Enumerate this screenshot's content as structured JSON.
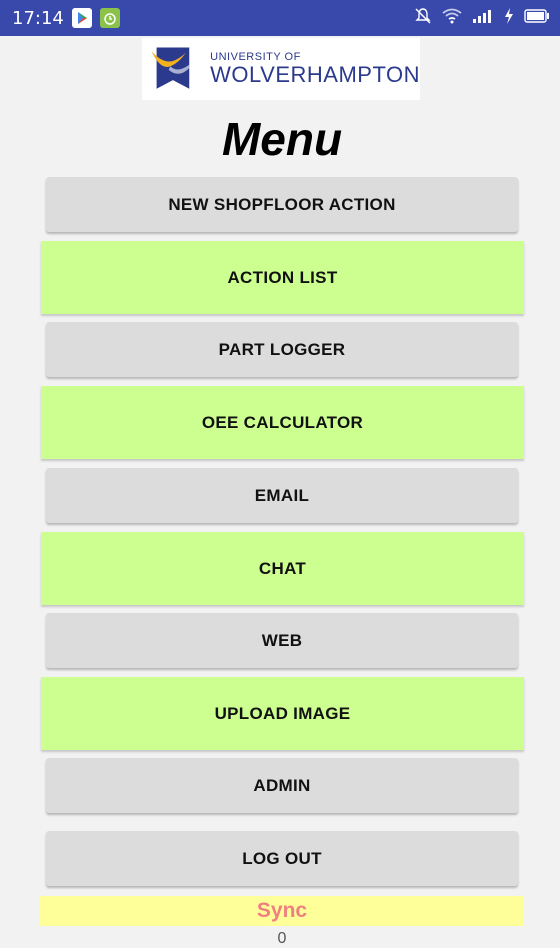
{
  "status_bar": {
    "time": "17:14",
    "icons": [
      "play-store-icon",
      "android-alarm-icon",
      "mute-bell-icon",
      "wifi-icon",
      "signal-icon",
      "charging-icon",
      "battery-icon"
    ],
    "color": "#3949ab"
  },
  "logo": {
    "line1": "UNIVERSITY OF",
    "line2": "WOLVERHAMPTON",
    "brand_color": "#2b3a8c",
    "accent_color": "#f2b01e"
  },
  "title": "Menu",
  "menu": {
    "items": [
      {
        "label": "NEW SHOPFLOOR ACTION",
        "style": "gray"
      },
      {
        "label": "ACTION LIST",
        "style": "green"
      },
      {
        "label": "PART LOGGER",
        "style": "gray"
      },
      {
        "label": "OEE CALCULATOR",
        "style": "green"
      },
      {
        "label": "EMAIL",
        "style": "gray"
      },
      {
        "label": "CHAT",
        "style": "green"
      },
      {
        "label": "WEB",
        "style": "gray"
      },
      {
        "label": "UPLOAD IMAGE",
        "style": "green"
      },
      {
        "label": "ADMIN",
        "style": "gray"
      },
      {
        "label": "LOG OUT",
        "style": "gray"
      }
    ],
    "colors": {
      "gray": "#dcdcdc",
      "green": "#ccff90"
    }
  },
  "sync": {
    "label": "Sync",
    "count": "0",
    "background": "#ffff99",
    "text_color": "#f08080"
  }
}
